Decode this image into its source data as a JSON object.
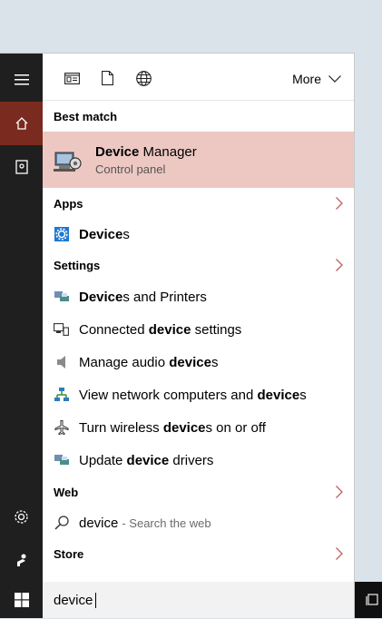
{
  "toolbar": {
    "more_label": "More"
  },
  "best_match": {
    "header": "Best match",
    "title_bold": "Device",
    "title_rest": " Manager",
    "subtitle": "Control panel"
  },
  "apps": {
    "header": "Apps",
    "items": [
      {
        "bold": "Device",
        "rest": "s",
        "icon": "devices-gear-icon"
      }
    ]
  },
  "settings": {
    "header": "Settings",
    "items": [
      {
        "pre": "",
        "bold": "Device",
        "post": "s and Printers",
        "icon": "printer-icon"
      },
      {
        "pre": "Connected ",
        "bold": "device",
        "post": " settings",
        "icon": "connected-devices-icon"
      },
      {
        "pre": "Manage audio ",
        "bold": "device",
        "post": "s",
        "icon": "speaker-icon"
      },
      {
        "pre": "View network computers and ",
        "bold": "device",
        "post": "s",
        "icon": "network-icon"
      },
      {
        "pre": "Turn wireless ",
        "bold": "device",
        "post": "s on or off",
        "icon": "airplane-icon"
      },
      {
        "pre": "Update ",
        "bold": "device",
        "post": " drivers",
        "icon": "driver-icon"
      }
    ]
  },
  "web": {
    "header": "Web",
    "query": "device",
    "suffix": "- Search the web"
  },
  "store": {
    "header": "Store"
  },
  "search": {
    "value": "device"
  },
  "colors": {
    "rail": "#1f1f1f",
    "rail_active": "#7a2a1e",
    "highlight": "#edc8c3",
    "accent_chevron": "#c06060"
  }
}
